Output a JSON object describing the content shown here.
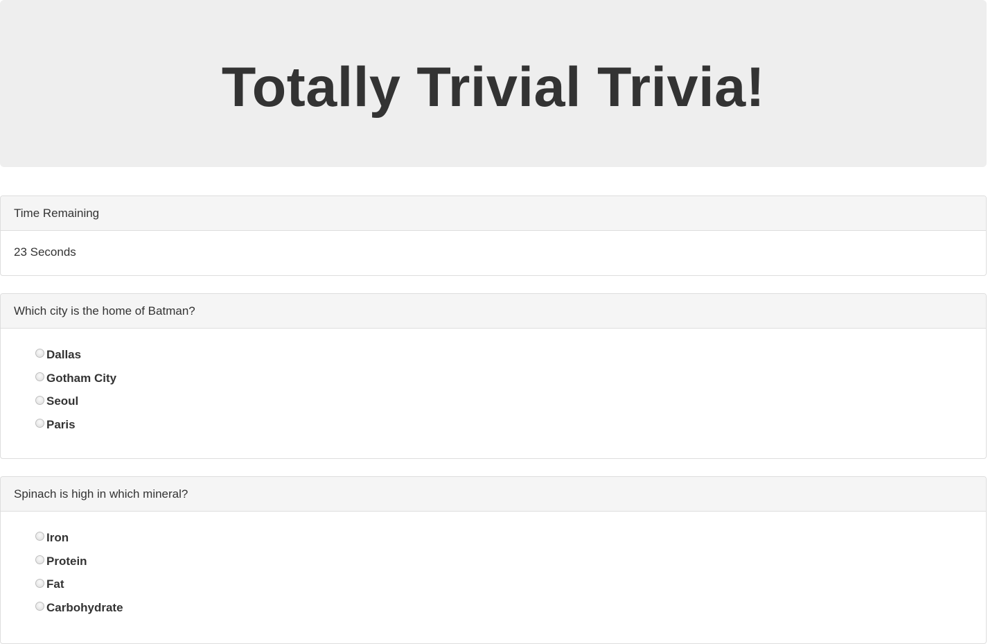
{
  "header": {
    "title": "Totally Trivial Trivia!"
  },
  "timer": {
    "heading": "Time Remaining",
    "value": "23 Seconds"
  },
  "questions": [
    {
      "text": "Which city is the home of Batman?",
      "options": [
        "Dallas",
        "Gotham City",
        "Seoul",
        "Paris"
      ]
    },
    {
      "text": "Spinach is high in which mineral?",
      "options": [
        "Iron",
        "Protein",
        "Fat",
        "Carbohydrate"
      ]
    }
  ],
  "colors": {
    "jumbotron_bg": "#eeeeee",
    "panel_heading_bg": "#f5f5f5",
    "border": "#dddddd",
    "text": "#333333"
  }
}
